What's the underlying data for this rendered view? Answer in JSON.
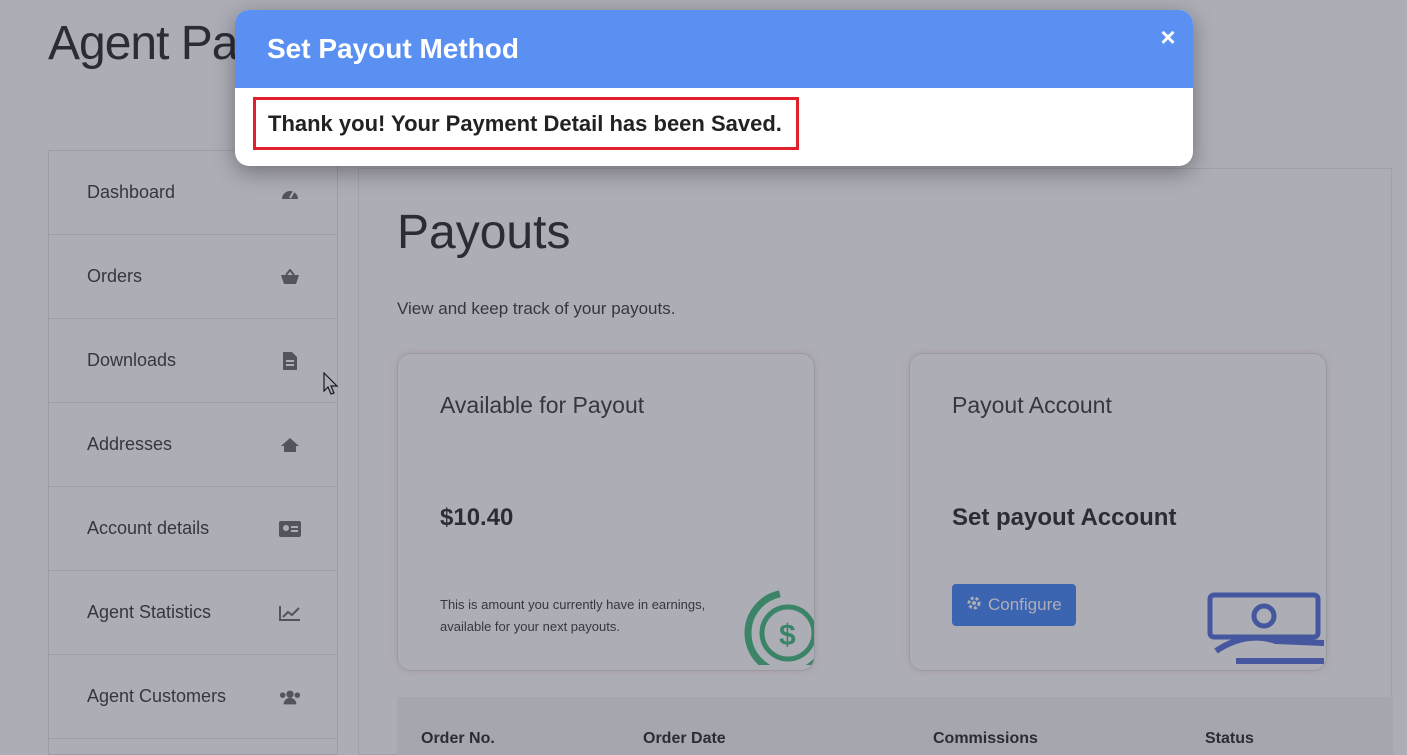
{
  "page": {
    "heading": "Agent Payouts"
  },
  "sidebar": {
    "items": [
      {
        "label": "Dashboard",
        "icon": "dashboard-icon"
      },
      {
        "label": "Orders",
        "icon": "basket-icon"
      },
      {
        "label": "Downloads",
        "icon": "file-icon"
      },
      {
        "label": "Addresses",
        "icon": "home-icon"
      },
      {
        "label": "Account details",
        "icon": "id-card-icon"
      },
      {
        "label": "Agent Statistics",
        "icon": "chart-icon"
      },
      {
        "label": "Agent Customers",
        "icon": "users-icon"
      }
    ]
  },
  "main": {
    "title": "Payouts",
    "subtitle": "View and keep track of your payouts.",
    "available_card": {
      "title": "Available for Payout",
      "value": "$10.40",
      "note": "This is amount you currently have in earnings, available for your next payouts."
    },
    "account_card": {
      "title": "Payout Account",
      "value": "Set payout Account",
      "button_label": "Configure"
    },
    "table": {
      "columns": [
        "Order No.",
        "Order Date",
        "Commissions",
        "Status"
      ]
    }
  },
  "modal": {
    "title": "Set Payout Method",
    "close_symbol": "×",
    "message": "Thank you! Your Payment Detail has been Saved."
  },
  "colors": {
    "modal_header": "#5b90f3",
    "highlight_border": "#e0202a",
    "button": "#3b82f6"
  }
}
